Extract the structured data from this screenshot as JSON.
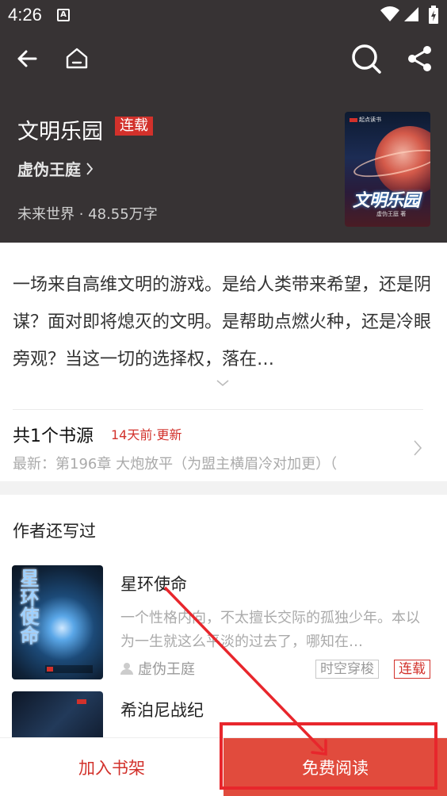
{
  "status_bar": {
    "time": "4:26",
    "notification_icon": "A"
  },
  "toolbar": {
    "back_icon": "arrow-left-icon",
    "home_icon": "home-icon",
    "search_icon": "search-icon",
    "share_icon": "share-icon"
  },
  "book": {
    "title": "文明乐园",
    "status_badge": "连载",
    "author": "虚伪王庭",
    "meta": "未来世界 · 48.55万字",
    "cover_title": "文明乐园",
    "cover_publisher": "起点读书",
    "cover_author": "虚伪王庭 著",
    "description": "一场来自高维文明的游戏。是给人类带来希望，还是阴谋？面对即将熄灭的文明。是帮助点燃火种，还是冷眼旁观？当这一切的选择权，落在…"
  },
  "source": {
    "title": "共1个书源",
    "update": "14天前·更新",
    "latest": "最新：第196章 大炮放平（为盟主横眉冷对加更）（"
  },
  "other_works": {
    "section_title": "作者还写过",
    "books": [
      {
        "title": "星环使命",
        "cover_title": "星环使命",
        "description": "一个性格内向，不太擅长交际的孤独少年。本以为一生就这么平淡的过去了，哪知在…",
        "author": "虚伪王庭",
        "tags": [
          "时空穿梭",
          "连载"
        ]
      },
      {
        "title": "希泊尼战纪"
      }
    ]
  },
  "bottom_bar": {
    "add_shelf": "加入书架",
    "read_free": "免费阅读"
  },
  "colors": {
    "accent": "#d2312b",
    "header_bg": "#373334",
    "read_button": "#e14b3d",
    "annotation": "#e8262c"
  }
}
